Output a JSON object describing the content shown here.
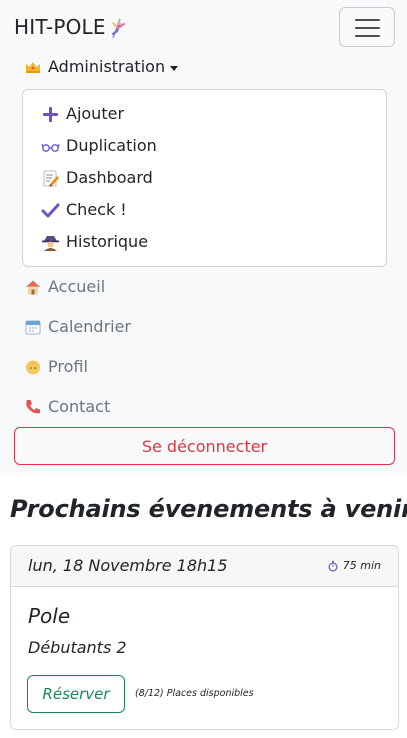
{
  "brand": {
    "name": "HIT-POLE",
    "icon": "pole-dancer-icon"
  },
  "colors": {
    "navbar_bg": "#f8f9fa",
    "danger": "#dc3545",
    "success": "#198754",
    "accent_purple": "#7052c8"
  },
  "nav": {
    "admin_label": "Administration",
    "admin_icon": "crown-icon",
    "dropdown_items": [
      {
        "label": "Ajouter",
        "icon": "plus-icon"
      },
      {
        "label": "Duplication",
        "icon": "glasses-icon"
      },
      {
        "label": "Dashboard",
        "icon": "memo-icon"
      },
      {
        "label": "Check !",
        "icon": "check-icon"
      },
      {
        "label": "Historique",
        "icon": "detective-icon"
      }
    ],
    "links": [
      {
        "label": "Accueil",
        "icon": "house-icon"
      },
      {
        "label": "Calendrier",
        "icon": "calendar-icon"
      },
      {
        "label": "Profil",
        "icon": "person-icon"
      },
      {
        "label": "Contact",
        "icon": "phone-icon"
      }
    ],
    "logout_label": "Se déconnecter"
  },
  "main": {
    "heading": "Prochains évenements à venir:",
    "event": {
      "date": "lun, 18 Novembre 18h15",
      "duration": "75 min",
      "duration_icon": "stopwatch-icon",
      "title": "Pole",
      "level": "Débutants 2",
      "reserve_label": "Réserver",
      "places_text": "(8/12) Places disponibles"
    }
  }
}
